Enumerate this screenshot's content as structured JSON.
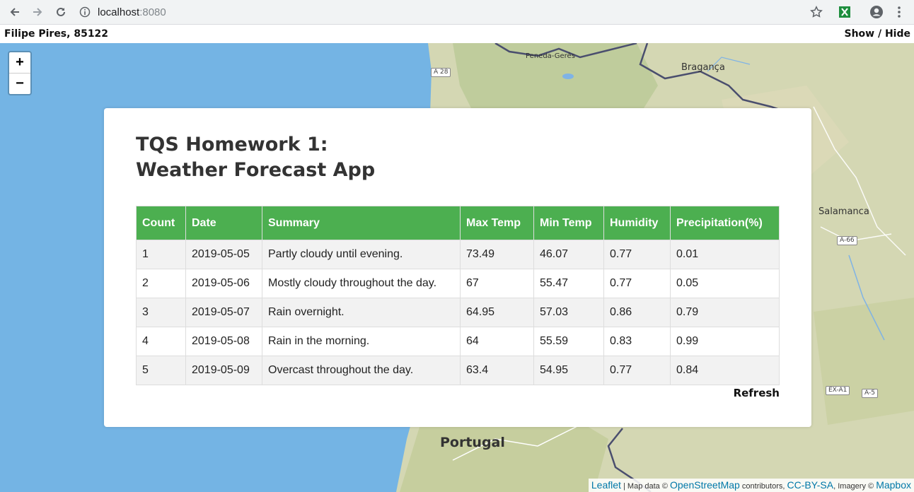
{
  "browser": {
    "url_host": "localhost",
    "url_port": ":8080"
  },
  "topbar": {
    "author": "Filipe Pires, 85122",
    "toggle": "Show / Hide"
  },
  "map": {
    "labels": {
      "braganca": "Bragança",
      "salamanca": "Salamanca",
      "portugal": "Portugal",
      "peneda": "Peneda-Gerês"
    },
    "roads": [
      "A 28",
      "A-66",
      "EX-A1",
      "A-5"
    ],
    "zoom_in": "+",
    "zoom_out": "−",
    "attribution": {
      "leaflet": "Leaflet",
      "sep1": " | Map data © ",
      "osm": "OpenStreetMap",
      "contributors": " contributors, ",
      "license": "CC-BY-SA",
      "imagery": ", Imagery © ",
      "mapbox": "Mapbox"
    }
  },
  "panel": {
    "title_line1": "TQS Homework 1:",
    "title_line2": "Weather Forecast App",
    "columns": [
      "Count",
      "Date",
      "Summary",
      "Max Temp",
      "Min Temp",
      "Humidity",
      "Precipitation(%)"
    ],
    "rows": [
      [
        "1",
        "2019-05-05",
        "Partly cloudy until evening.",
        "73.49",
        "46.07",
        "0.77",
        "0.01"
      ],
      [
        "2",
        "2019-05-06",
        "Mostly cloudy throughout the day.",
        "67",
        "55.47",
        "0.77",
        "0.05"
      ],
      [
        "3",
        "2019-05-07",
        "Rain overnight.",
        "64.95",
        "57.03",
        "0.86",
        "0.79"
      ],
      [
        "4",
        "2019-05-08",
        "Rain in the morning.",
        "64",
        "55.59",
        "0.83",
        "0.99"
      ],
      [
        "5",
        "2019-05-09",
        "Overcast throughout the day.",
        "63.4",
        "54.95",
        "0.77",
        "0.84"
      ]
    ],
    "refresh": "Refresh"
  }
}
